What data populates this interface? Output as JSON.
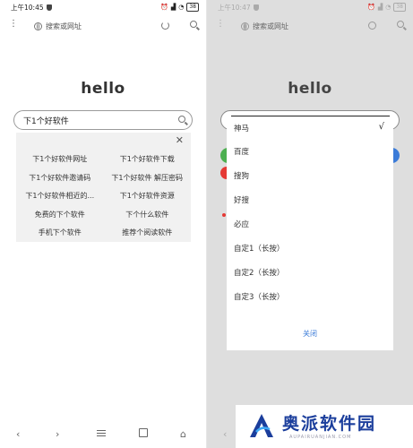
{
  "left": {
    "status": {
      "time": "上午10:45",
      "battery": "38"
    },
    "toolbar": {
      "address_placeholder": "搜索或网址"
    },
    "logo_text": "hello",
    "search": {
      "query": "下1个好软件"
    },
    "suggestions": [
      "下1个好软件网址",
      "下1个好软件下载",
      "下1个好软件邀请码",
      "下1个好软件 解压密码",
      "下1个好软件相近的...",
      "下1个好软件资源",
      "免费的下个软件",
      "下个什么软件",
      "手机下个软件",
      "推荐个阅读软件"
    ],
    "navbar": {
      "back": "‹",
      "forward": "›",
      "home": "⌂"
    }
  },
  "right": {
    "status": {
      "time": "上午10:47",
      "battery": "38"
    },
    "toolbar": {
      "address_placeholder": "搜索或网址"
    },
    "logo_text": "hello",
    "engines": [
      {
        "label": "神马",
        "checked": true
      },
      {
        "label": "百度",
        "checked": false
      },
      {
        "label": "搜狗",
        "checked": false
      },
      {
        "label": "好搜",
        "checked": false
      },
      {
        "label": "必应",
        "checked": false
      },
      {
        "label": "自定1（长按）",
        "checked": false
      },
      {
        "label": "自定2（长按）",
        "checked": false
      },
      {
        "label": "自定3（长按）",
        "checked": false
      }
    ],
    "check_mark": "√",
    "close_label": "关闭"
  },
  "watermark": {
    "text": "奥派软件园",
    "url": "AUPAIRUANJIAN.COM",
    "color": "#1b3e9c"
  }
}
